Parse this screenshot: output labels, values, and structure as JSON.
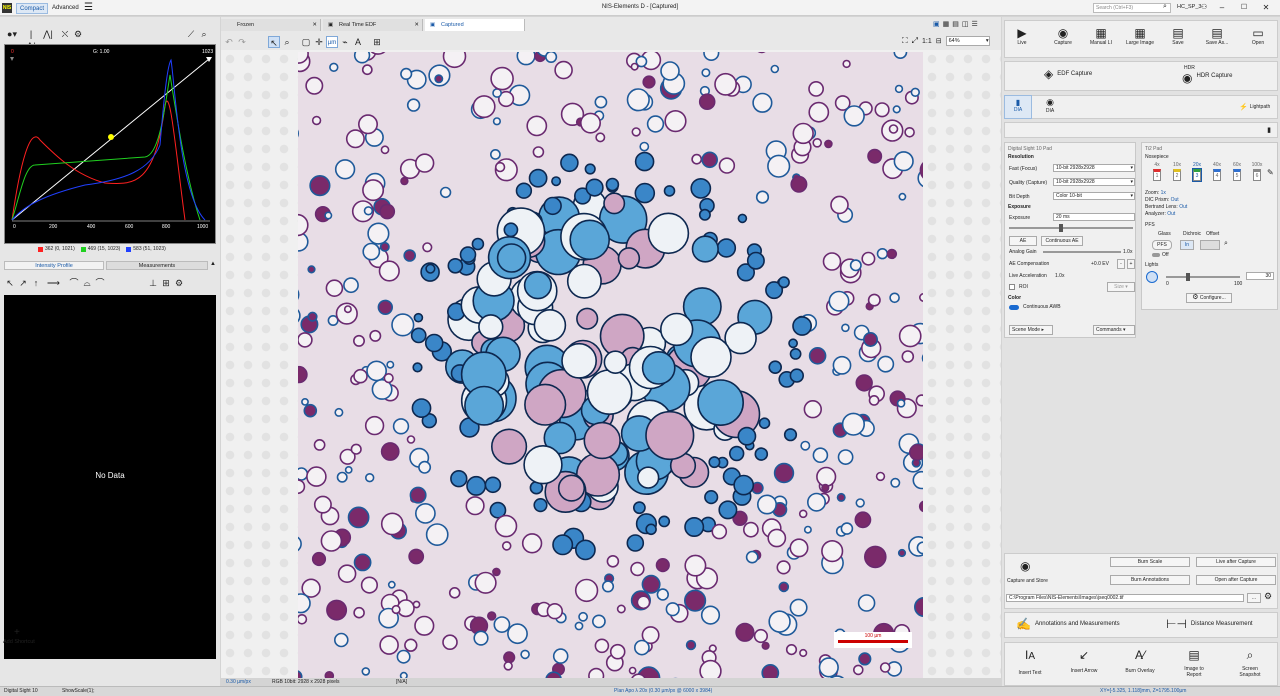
{
  "app": {
    "logo": "NIS",
    "title": "NIS-Elements D - [Captured]",
    "modes": [
      "Compact",
      "Advanced"
    ],
    "search_placeholder": "Search (Ctrl+F3)",
    "user": "HC_SP_3"
  },
  "left": {
    "gamma": "G: 1.00",
    "hist_min": "0",
    "hist_max": "1023",
    "x_ticks": [
      "0",
      "200",
      "400",
      "600",
      "800",
      "1000"
    ],
    "legend": [
      {
        "text": "362 (0, 1021)",
        "color": "#ff2020"
      },
      {
        "text": "469 (15, 1023)",
        "color": "#20d020"
      },
      {
        "text": "583 (51, 1023)",
        "color": "#2040ff"
      }
    ],
    "tabs": [
      "Intensity Profile",
      "Measurements"
    ],
    "no_data": "No Data",
    "add_shortcut": "Add Shortcut"
  },
  "center": {
    "tabs": [
      "Frozen",
      "Real Time EDF",
      "Captured"
    ],
    "zoom": "64%",
    "one_to_one": "1:1",
    "scale_label": "100 µm"
  },
  "right": {
    "top_buttons": [
      "Live",
      "Capture",
      "Manual LI",
      "Large Image",
      "Save",
      "Save As...",
      "Open"
    ],
    "edf": "EDF Capture",
    "hdr": "HDR Capture",
    "hdr_badge": "HDR",
    "dia": "DIA",
    "dia2": "DIA",
    "lightpath": "Lightpath",
    "camera": {
      "title": "Digital Sight 10 Pad",
      "resolution": "Resolution",
      "fast_label": "Fast (Focus)",
      "fast_val": "10-bit 2928x2928",
      "quality_label": "Quality (Capture)",
      "quality_val": "10-bit 2928x2928",
      "bitdepth_label": "Bit Depth",
      "bitdepth_val": "Color 10-bit",
      "exposure_hdr": "Exposure",
      "exposure_label": "Exposure",
      "exposure_val": "20 ms",
      "ae": "AE",
      "cont_ae": "Continuous AE",
      "analog_gain": "Analog Gain",
      "gain_val": "1.0x",
      "ae_comp": "AE Compensation",
      "ae_comp_val": "+0.0 EV",
      "live_accel": "Live Acceleration",
      "live_accel_val": "1.0x",
      "roi": "ROI",
      "size": "Size",
      "color_hdr": "Color",
      "awb": "Continuous AWB",
      "scene": "Scene Mode",
      "commands": "Commands"
    },
    "ti2": {
      "title": "Ti2 Pad",
      "nosepiece": "Nosepiece",
      "objectives": [
        "4x",
        "10x",
        "20x",
        "40x",
        "60x",
        "100x"
      ],
      "obj_nums": [
        "1",
        "2",
        "3",
        "4",
        "5",
        "6"
      ],
      "obj_colors": [
        "#e03030",
        "#e0c020",
        "#30a040",
        "#3070d0",
        "#3070d0",
        "#888888"
      ],
      "zoom_l": "Zoom:",
      "zoom_v": "1x",
      "dic_l": "DIC Prism:",
      "dic_v": "Out",
      "bert_l": "Bertrand Lens:",
      "bert_v": "Out",
      "analyzer_l": "Analyzer:",
      "analyzer_v": "Out",
      "pfs": "PFS",
      "glass": "Glass",
      "dichroic": "Dichroic",
      "offset": "Offset",
      "pfs_btn": "PFS",
      "in_btn": "In",
      "off": "Off",
      "lights": "Lights",
      "light_min": "0",
      "light_max": "100",
      "light_val": "30",
      "configure": "Configure..."
    },
    "burn_scale": "Burn Scale",
    "live_after": "Live after Capture",
    "capture_store": "Capture and Store",
    "burn_ann": "Burn Annotations",
    "open_after": "Open after Capture",
    "path": "C:\\Program Files\\NIS-Elements\\Images\\jseq0002.tif",
    "browse": "...",
    "ann_meas": "Annotations and Measurements",
    "dist_meas": "Distance Measurement",
    "bottom_buttons": [
      "Insert Text",
      "Insert Arrow",
      "Burn Overlay",
      "Image to Report",
      "Screen Snapshot"
    ]
  },
  "status": {
    "left1": "Digital Sight 10",
    "left2": "ShowScale(1);",
    "pixel": "0.30 µm/px",
    "rgb": "RGB 10bit: 2928 x 2928 pixels",
    "na": "[N/A]",
    "objective": "Plan Apo λ 20x (0.30 µm/px @ 6000 x 3984)",
    "coords": "XY=[-5.325, 1.118]mm, Z=1795.100µm"
  }
}
